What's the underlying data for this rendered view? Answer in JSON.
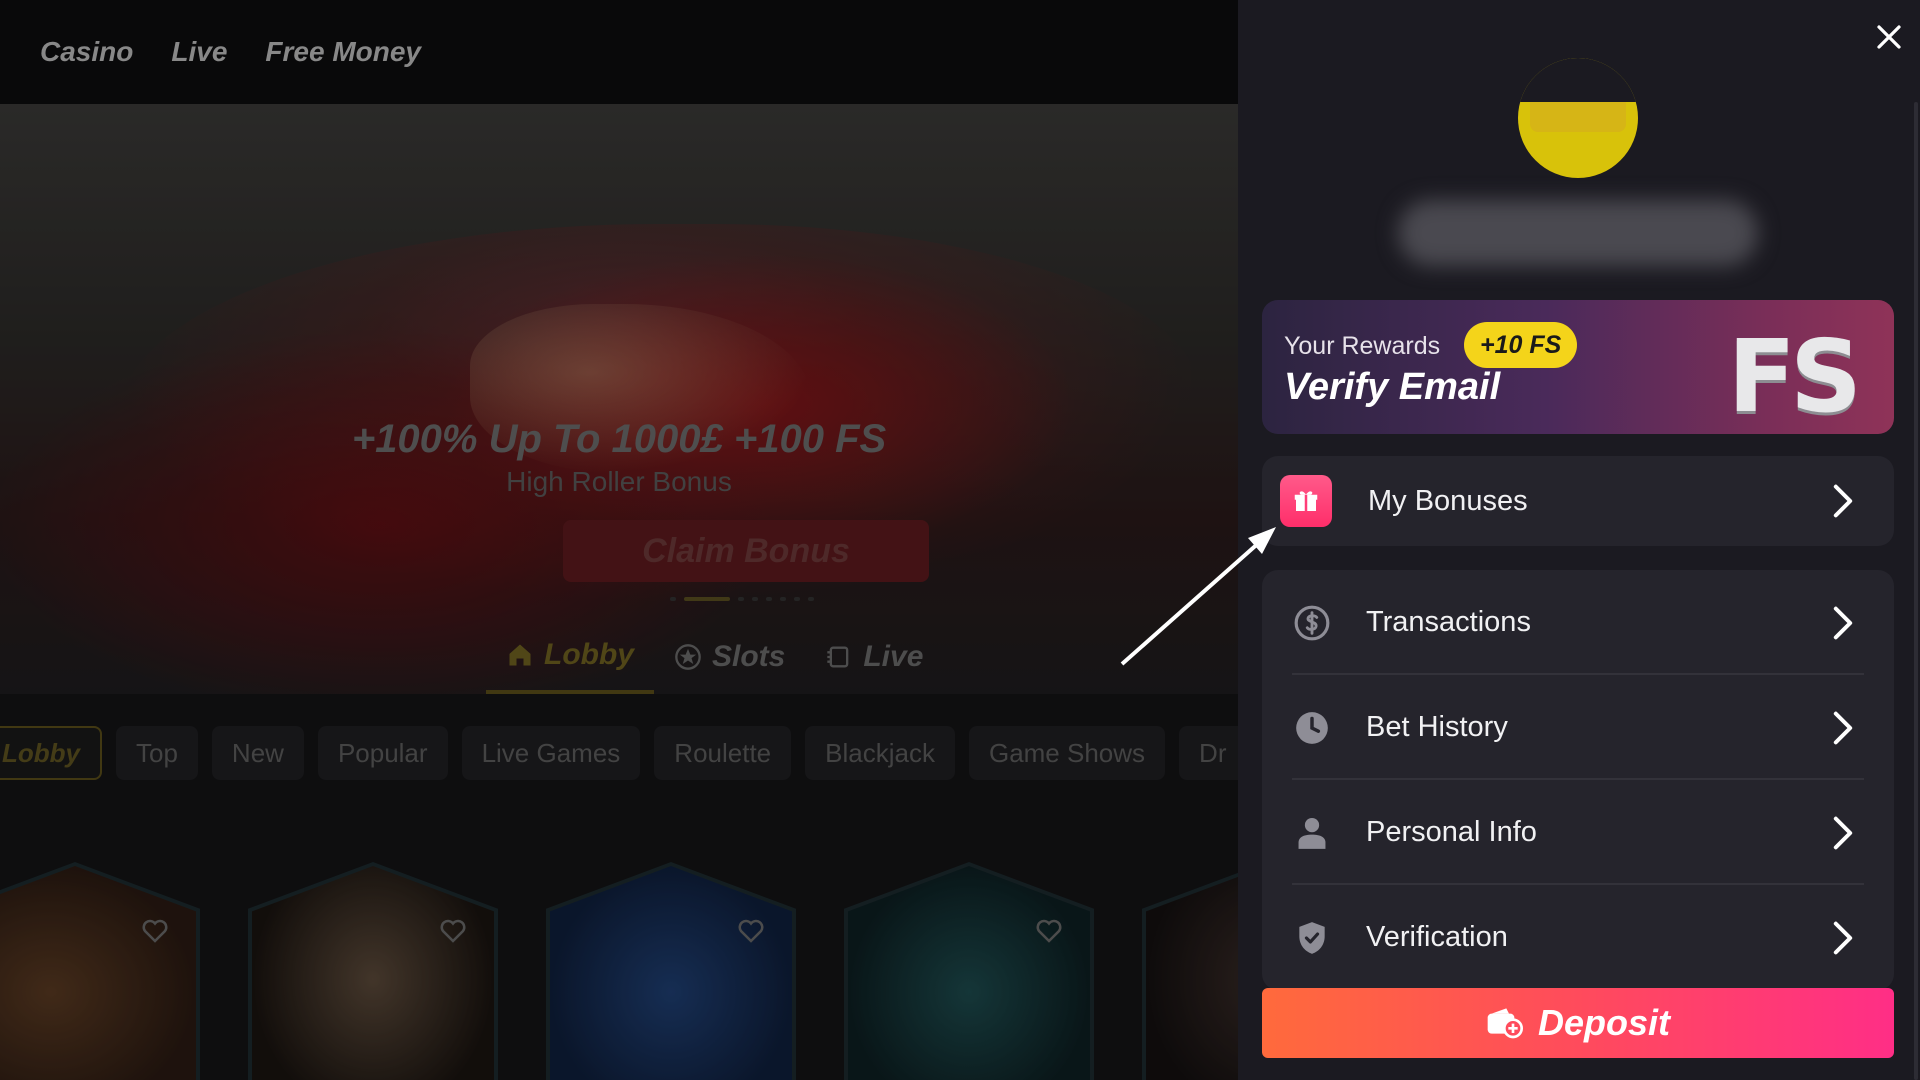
{
  "topnav": {
    "links": [
      "Casino",
      "Live",
      "Free Money"
    ]
  },
  "hero": {
    "title": "+100% Up To 1000£ +100 FS",
    "subtitle": "High Roller Bonus",
    "cta": "Claim Bonus"
  },
  "category_tabs": [
    {
      "label": "Lobby",
      "icon": "home-icon",
      "active": true
    },
    {
      "label": "Slots",
      "icon": "star-icon",
      "active": false
    },
    {
      "label": "Live",
      "icon": "live-cards-icon",
      "active": false
    }
  ],
  "chips": [
    "Lobby",
    "Top",
    "New",
    "Popular",
    "Live Games",
    "Roulette",
    "Blackjack",
    "Game Shows",
    "Dr"
  ],
  "panel": {
    "rewards": {
      "label": "Your Rewards",
      "badge": "+10 FS",
      "title": "Verify Email",
      "logo": "FS"
    },
    "menu_primary": [
      {
        "label": "My Bonuses",
        "icon": "gift-icon"
      }
    ],
    "menu_secondary": [
      {
        "label": "Transactions",
        "icon": "dollar-circle-icon"
      },
      {
        "label": "Bet History",
        "icon": "clock-icon"
      },
      {
        "label": "Personal Info",
        "icon": "user-icon"
      },
      {
        "label": "Verification",
        "icon": "shield-check-icon"
      }
    ],
    "deposit_label": "Deposit"
  },
  "colors": {
    "panel_bg": "#1b1a21",
    "card_bg": "#25242c",
    "accent_yellow": "#f4d41a",
    "gift_pink": "#ff3d78",
    "deposit_start": "#ff6a3c",
    "deposit_end": "#ff2e86"
  }
}
